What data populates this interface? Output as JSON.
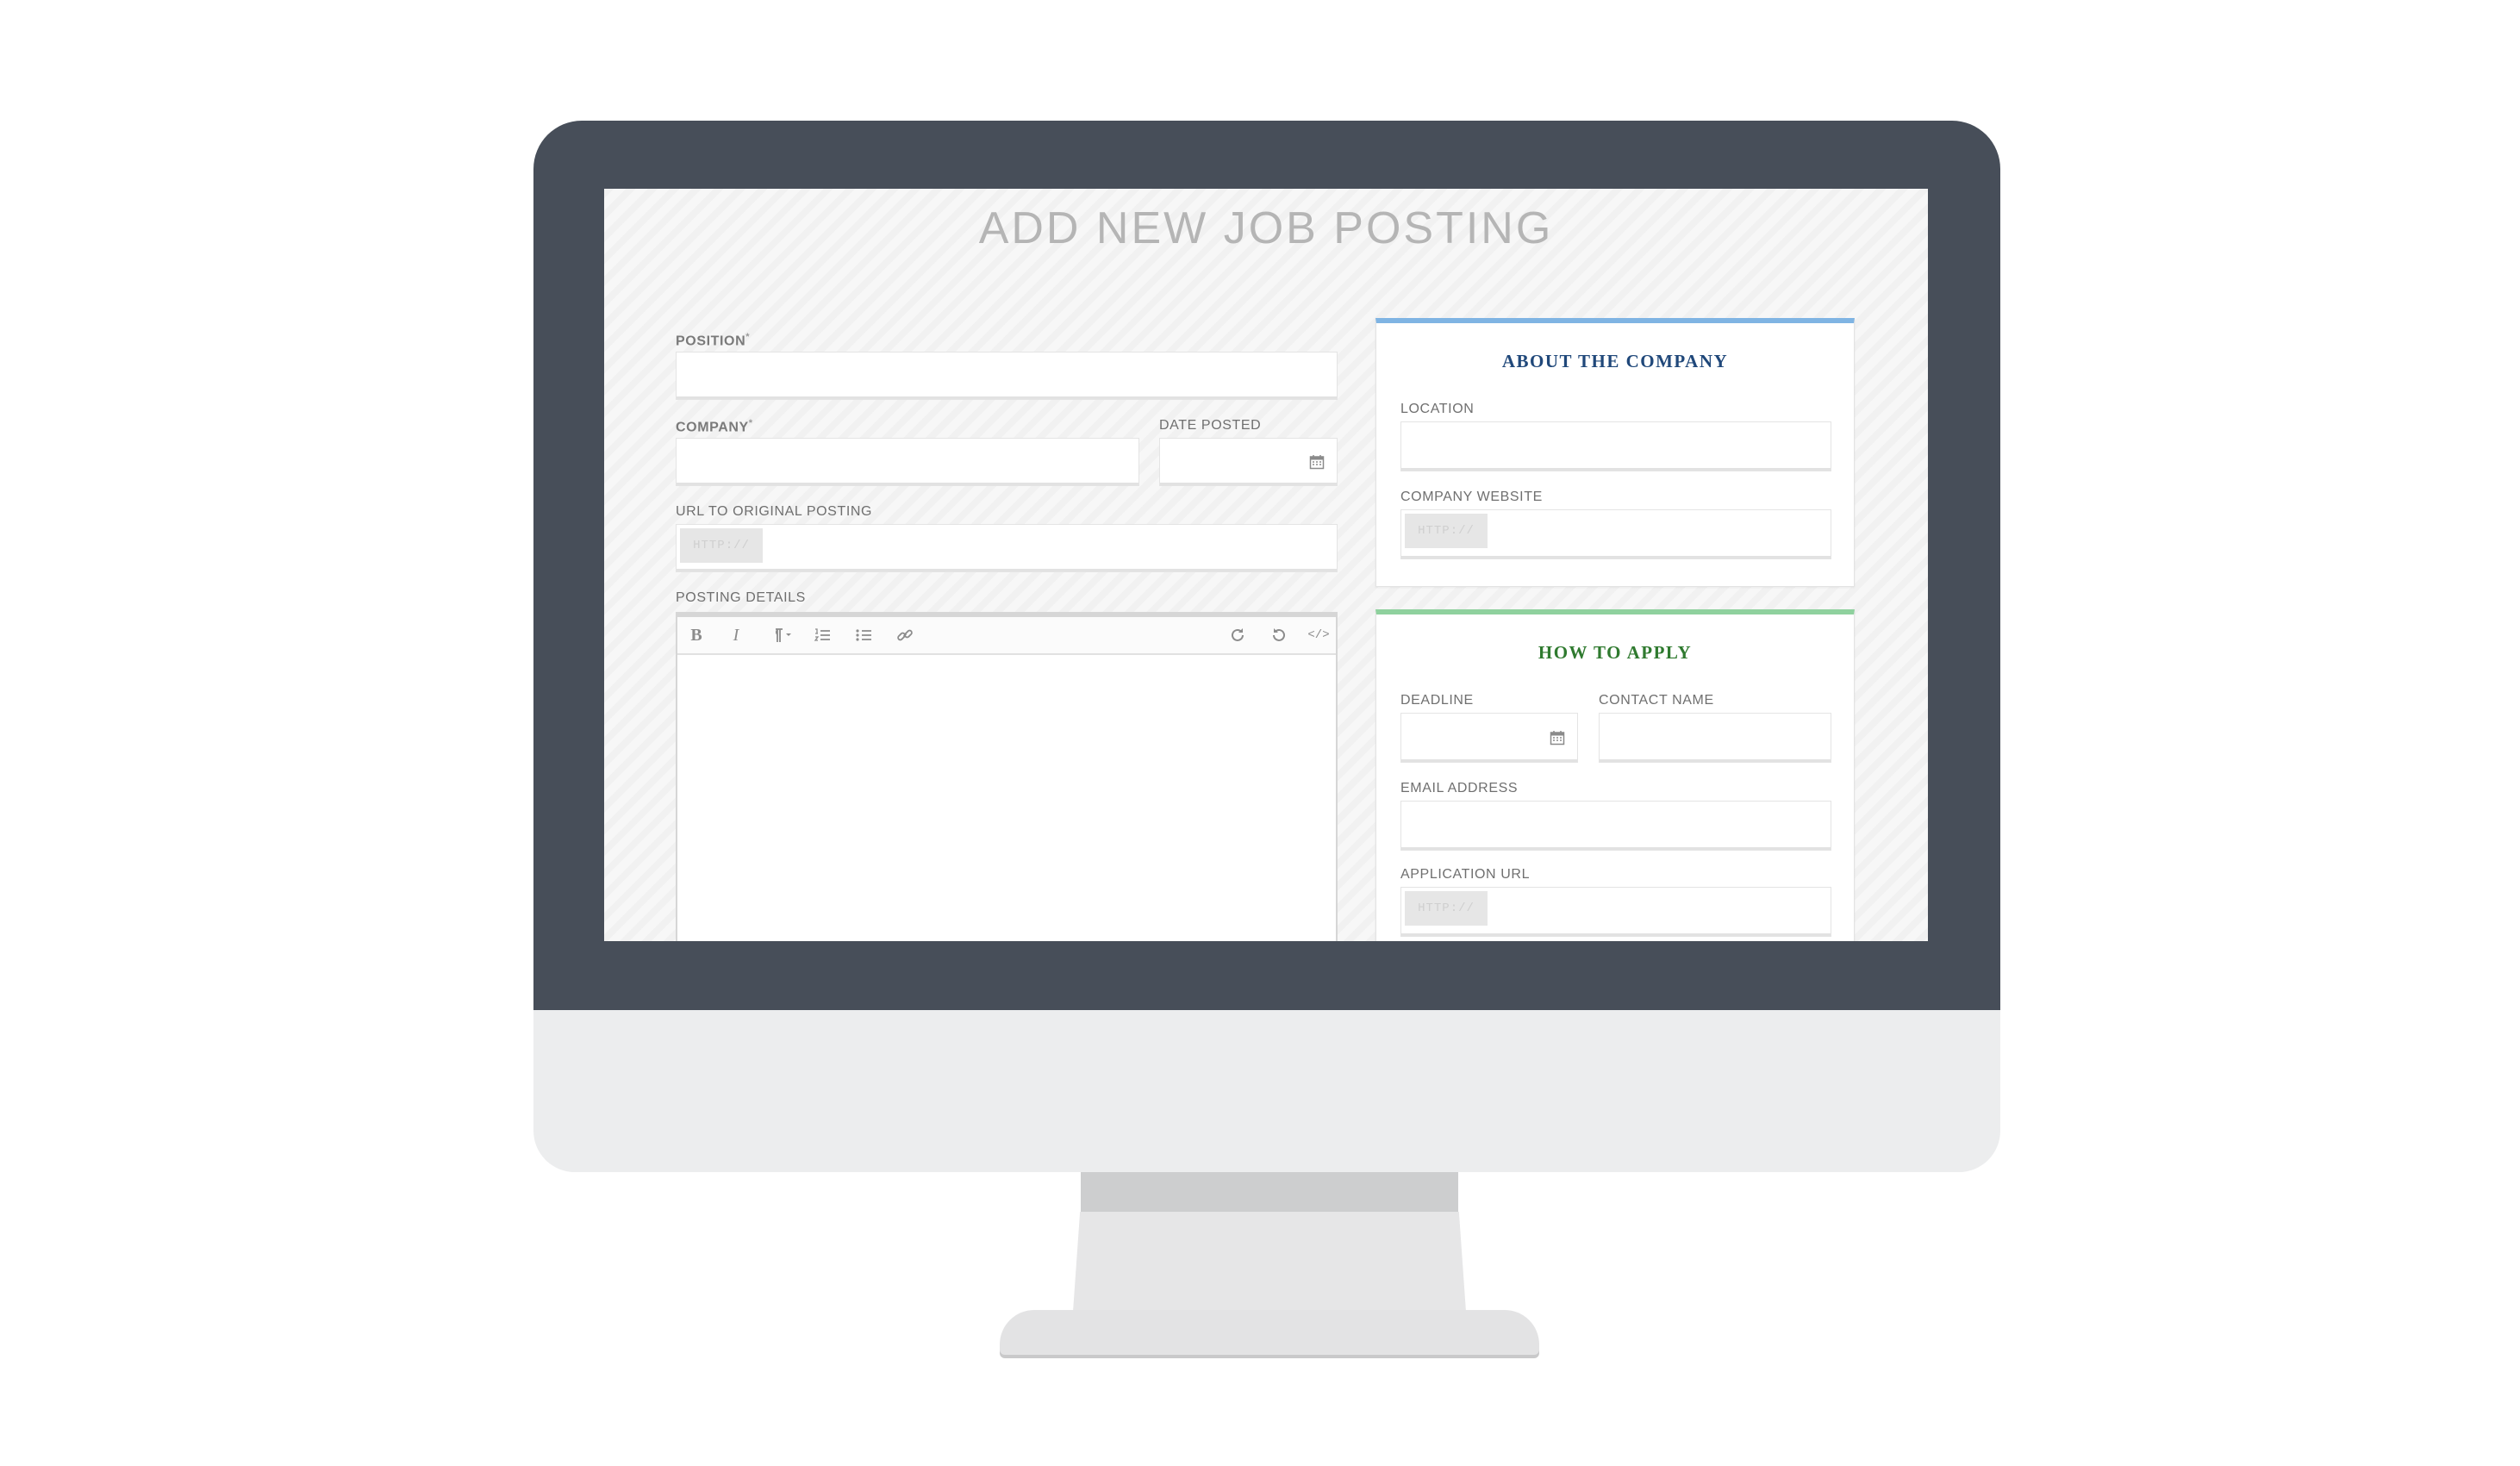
{
  "page": {
    "title": "ADD NEW JOB POSTING"
  },
  "form": {
    "position_label": "POSITION",
    "company_label": "COMPANY",
    "required_mark": "*",
    "date_posted_label": "DATE POSTED",
    "url_label": "URL TO ORIGINAL POSTING",
    "url_prefix": "HTTP://",
    "details_label": "POSTING DETAILS"
  },
  "editor": {
    "tools": [
      {
        "name": "bold-icon",
        "glyph": "B"
      },
      {
        "name": "italic-icon",
        "glyph": "I"
      },
      {
        "name": "paragraph-format-icon",
        "glyph": "¶"
      },
      {
        "name": "ordered-list-icon"
      },
      {
        "name": "unordered-list-icon"
      },
      {
        "name": "link-icon"
      },
      {
        "name": "redo-icon"
      },
      {
        "name": "undo-icon"
      },
      {
        "name": "code-view-icon",
        "glyph": "</>"
      }
    ]
  },
  "about_company": {
    "title": "ABOUT THE COMPANY",
    "location_label": "LOCATION",
    "website_label": "COMPANY WEBSITE",
    "website_prefix": "HTTP://",
    "accent_color": "#7fb4e3"
  },
  "how_to_apply": {
    "title": "HOW TO APPLY",
    "deadline_label": "DEADLINE",
    "contact_name_label": "CONTACT NAME",
    "email_label": "EMAIL ADDRESS",
    "app_url_label": "APPLICATION URL",
    "app_url_prefix": "HTTP://",
    "accent_color": "#8fd19e"
  }
}
